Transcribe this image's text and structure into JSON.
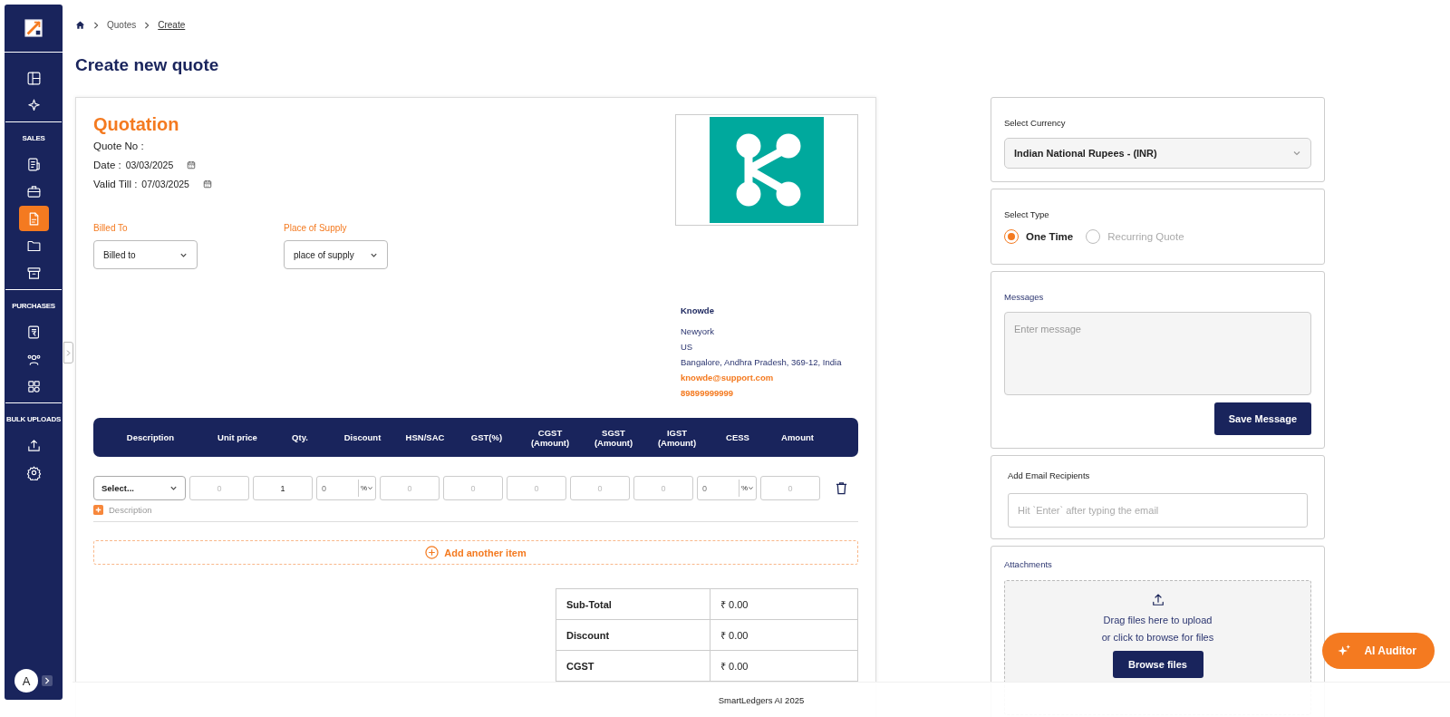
{
  "sidebar": {
    "sections": [
      {
        "items": [
          {
            "selected": false
          },
          {
            "selected": false
          }
        ]
      },
      {
        "label": "SALES",
        "items": [
          {
            "selected": false
          },
          {
            "selected": false
          },
          {
            "selected": true
          },
          {
            "selected": false
          },
          {
            "selected": false
          }
        ]
      },
      {
        "label": "PURCHASES",
        "items": [
          {
            "selected": false
          },
          {
            "selected": false
          },
          {
            "selected": false
          }
        ]
      },
      {
        "label": "BULK UPLOADS",
        "items": [
          {
            "selected": false
          },
          {
            "selected": false
          }
        ]
      }
    ],
    "avatar": "A"
  },
  "breadcrumb": [
    "Quotes",
    "Create"
  ],
  "page_title": "Create new quote",
  "quote": {
    "title": "Quotation",
    "quote_no_label": "Quote No :",
    "dates": [
      {
        "label": "Date :",
        "value": "03/03/2025"
      },
      {
        "label": "Valid Till :",
        "value": "07/03/2025"
      }
    ],
    "selects": [
      {
        "label": "Billed To",
        "value": "Billed to"
      },
      {
        "label": "Place of Supply",
        "value": "place of supply"
      }
    ],
    "company": {
      "name": "Knowde",
      "lines": [
        "Newyork",
        "US",
        "Bangalore, Andhra Pradesh, 369-12, India"
      ],
      "email": "knowde@support.com",
      "phone": "89899999999"
    }
  },
  "items_table": {
    "columns": [
      "Description",
      "Unit price",
      "Qty.",
      "Discount",
      "HSN/SAC",
      "GST(%)",
      "CGST (Amount)",
      "SGST (Amount)",
      "IGST (Amount)",
      "CESS",
      "Amount"
    ],
    "rows": [
      {
        "description_placeholder": "Description",
        "cells": [
          {
            "kind": "select",
            "value": "Select..."
          },
          {
            "kind": "input",
            "placeholder": "0"
          },
          {
            "kind": "input",
            "value": "1"
          },
          {
            "kind": "unit",
            "value": "0",
            "unit": "%"
          },
          {
            "kind": "input",
            "placeholder": "0"
          },
          {
            "kind": "input",
            "placeholder": "0"
          },
          {
            "kind": "input",
            "placeholder": "0"
          },
          {
            "kind": "input",
            "placeholder": "0"
          },
          {
            "kind": "input",
            "placeholder": "0"
          },
          {
            "kind": "unit",
            "value": "0",
            "unit": "%"
          },
          {
            "kind": "input",
            "placeholder": "0"
          }
        ]
      }
    ],
    "add_item": "Add another item"
  },
  "totals": [
    {
      "label": "Sub-Total",
      "value": "₹ 0.00"
    },
    {
      "label": "Discount",
      "value": "₹ 0.00"
    },
    {
      "label": "CGST",
      "value": "₹ 0.00"
    }
  ],
  "currency": {
    "label": "Select Currency",
    "value": "Indian National Rupees - (INR)"
  },
  "quote_type": {
    "label": "Select Type",
    "options": [
      {
        "label": "One Time",
        "selected": true
      },
      {
        "label": "Recurring Quote",
        "selected": false
      }
    ]
  },
  "messages": {
    "label": "Messages",
    "placeholder": "Enter message",
    "button": "Save Message"
  },
  "email_recipients": {
    "label": "Add Email Recipients",
    "placeholder": "Hit `Enter` after typing the email"
  },
  "attachments": {
    "label": "Attachments",
    "lines": [
      "Drag files here to upload",
      "or click to browse for files"
    ],
    "button": "Browse files"
  },
  "ai_button": "AI Auditor",
  "footer": "SmartLedgers AI 2025"
}
